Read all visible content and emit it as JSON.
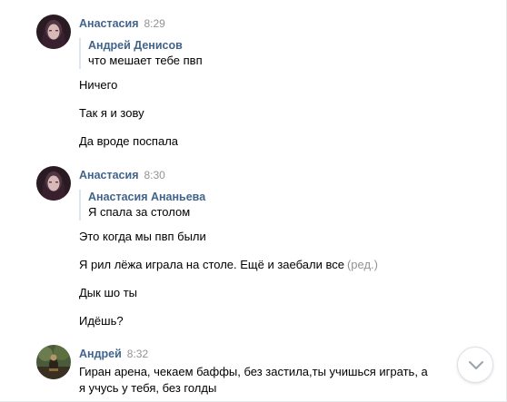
{
  "messages": [
    {
      "author": "Анастасия",
      "time": "8:29",
      "quote": {
        "author": "Андрей Денисов",
        "text": "что мешает тебе пвп"
      },
      "lines": [
        "Ничего",
        "Так я и зову",
        "Да вроде поспала"
      ]
    },
    {
      "author": "Анастасия",
      "time": "8:30",
      "quote": {
        "author": "Анастасия Ананьева",
        "text": "Я спала за столом"
      },
      "lines": [
        "Это когда мы пвп были",
        "Я рил лёжа играла на столе. Ещё и заебали все",
        "Дык шо ты",
        "Идёшь?"
      ],
      "edited_label": "(ред.)"
    },
    {
      "author": "Андрей",
      "time": "8:32",
      "text": "Гиран арена, чекаем баффы, без застила,ты учишься играть, а я учусь у тебя, без голды"
    }
  ],
  "icons": {
    "scroll_down": "chevron-down-icon"
  },
  "colors": {
    "author": "#42648b",
    "time": "#939393",
    "quote_bar": "#dfe5ec"
  }
}
